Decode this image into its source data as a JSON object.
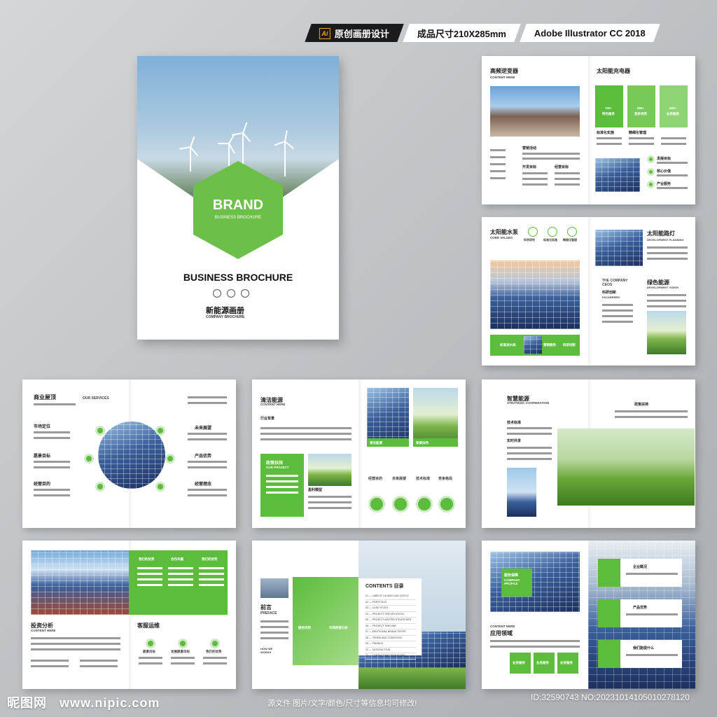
{
  "header": {
    "tag1": "原创画册设计",
    "tag2": "成品尺寸210X285mm",
    "tag3": "Adobe Illustrator CC 2018",
    "ai_icon": "Ai"
  },
  "cover": {
    "brand": "BRAND",
    "brand_sub": "BUSINESS BROCHURE",
    "title": "BUSINESS BROCHURE",
    "cn_title": "新能源画册",
    "en_sub": "COMPANY BROCHURE"
  },
  "spread1": {
    "left_title": "高频逆变器",
    "left_sub": "CONTENT HERE",
    "mid_label": "营销活动",
    "label_a": "开发目标",
    "label_b": "经营目标",
    "right_title": "太阳能充电器",
    "box1": "750+",
    "box1_label": "特色服务",
    "box2": "650+",
    "box2_label": "竞争优势",
    "box3": "500+",
    "box3_label": "业务服务",
    "label_c": "标准化实施",
    "label_d": "精细化管理",
    "side1": "发展目标",
    "side2": "核心价值",
    "side3": "产业服务"
  },
  "spread2": {
    "left_title": "太阳能水泵",
    "left_sub": "CORE VALUES",
    "icon1": "科学研究",
    "icon2": "标准化实施",
    "icon3": "精细化管理",
    "bar1": "标准流水线",
    "bar2": "营销服务",
    "bar3": "科研创新",
    "right_title1": "太阳能路灯",
    "right_sub1": "DEVELOPMENT PLANNING",
    "company": "THE COMPANY CEOS",
    "ceo_cn": "科研创新",
    "ceo_sub": "FACAREREN",
    "right_title2": "绿色能源",
    "right_sub2": "DEVELOPMENT VISION"
  },
  "spread3": {
    "title": "商业屋顶",
    "services": "OUR SERVICES",
    "l1": "市场定位",
    "l2": "愿景目标",
    "l3": "经营目的",
    "r1": "未来展望",
    "r2": "产品优势",
    "r3": "经营理念"
  },
  "spread4": {
    "title": "清洁能源",
    "sub": "CONTENT HERE",
    "label": "行业背景",
    "box_title": "政策扶持",
    "box_sub": "OUR PROJECT",
    "model": "盈利模型",
    "img1": "清洁能源",
    "img2": "政策扶持",
    "img3": "投资分析",
    "c1": "经营目的",
    "c2": "未来展望",
    "c3": "技术标准",
    "c4": "竞争格局"
  },
  "spread5": {
    "title": "智慧能源",
    "sub": "STRATEGIC COOPERATION",
    "l1": "技术标准",
    "l2": "实时共享",
    "r1": "政策扶持"
  },
  "spread6": {
    "t1": "我们的优势",
    "t2": "合作共赢",
    "t3": "我们的优势",
    "title": "投资分析",
    "sub": "CONTENT HERE",
    "svc": "客服运维",
    "i1": "愿景目标",
    "i2": "发展愿景目标",
    "i3": "我们的优势"
  },
  "spread7": {
    "title": "前言",
    "sub": "PREFACE",
    "who": "HOW WE WORKS",
    "box1": "服务优势",
    "box2": "市场经营分析",
    "contents": "CONTENTS 目录",
    "toc": [
      "01 — LABELIT LIA MAS LIAS CIRCLE",
      "02 — PORTFOLIO",
      "03 — CASE STUDY",
      "04 — PROJECT SPECIFICATION",
      "05 — PROJECT MATTER STRATEGIES",
      "06 — PROJECT TIMELINE",
      "07 — ADDITIONAL BRAND OFFER",
      "08 — TERMS AND CONDITION",
      "09 — FINANCE",
      "10 — SATISFACTION",
      "11 — CONTACT AND SIGNATURE"
    ]
  },
  "spread8": {
    "box_title": "服务保障",
    "box_sub": "COMPANY PROFILE",
    "sub": "CONTENT HERE",
    "title": "应用领域",
    "g1": "业务服务",
    "g2": "业务服务",
    "g3": "业务服务",
    "r1": "企业概况",
    "r2": "产品优势",
    "r3": "我们能提什么"
  },
  "footer": {
    "site_logo": "昵图网",
    "site_url": "www.nipic.com",
    "note": "源文件 图片/文字/颜色/尺寸等信息均可修改!",
    "id": "ID:32590743 NO:20231014105010278120"
  }
}
